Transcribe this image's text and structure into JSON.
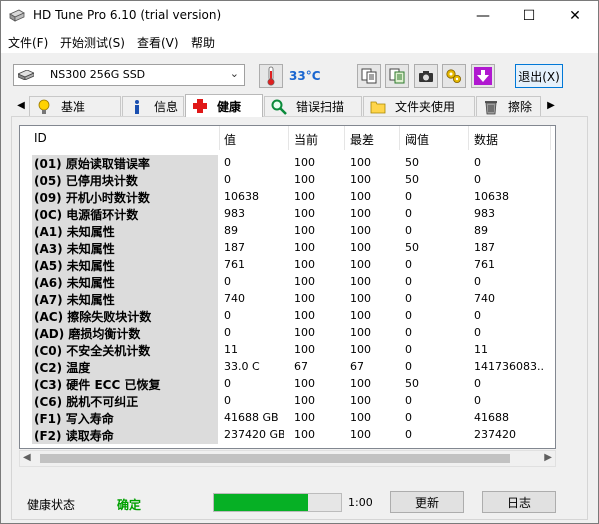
{
  "window": {
    "title": "HD Tune Pro 6.10 (trial version)",
    "controls": {
      "minimize": "—",
      "maximize": "☐",
      "close": "✕"
    }
  },
  "menu": [
    "文件(F)",
    "开始测试(S)",
    "查看(V)",
    "帮助"
  ],
  "toolbar": {
    "drive": "NS300 256G SSD",
    "temperature": "33°C",
    "exit_label": "退出(X)"
  },
  "tabs": [
    {
      "label": "基准",
      "icon": "lightbulb-icon"
    },
    {
      "label": "信息",
      "icon": "info-icon"
    },
    {
      "label": "健康",
      "icon": "health-cross-icon",
      "active": true
    },
    {
      "label": "错误扫描",
      "icon": "magnifier-icon"
    },
    {
      "label": "文件夹使用",
      "icon": "folder-icon"
    },
    {
      "label": "擦除",
      "icon": "trash-icon"
    }
  ],
  "table": {
    "headers": [
      "ID",
      "值",
      "当前",
      "最差",
      "阈值",
      "数据"
    ],
    "rows": [
      [
        "(01) 原始读取错误率",
        "0",
        "100",
        "100",
        "50",
        "0"
      ],
      [
        "(05) 已停用块计数",
        "0",
        "100",
        "100",
        "50",
        "0"
      ],
      [
        "(09) 开机小时数计数",
        "10638",
        "100",
        "100",
        "0",
        "10638"
      ],
      [
        "(0C) 电源循环计数",
        "983",
        "100",
        "100",
        "0",
        "983"
      ],
      [
        "(A1) 未知属性",
        "89",
        "100",
        "100",
        "0",
        "89"
      ],
      [
        "(A3) 未知属性",
        "187",
        "100",
        "100",
        "50",
        "187"
      ],
      [
        "(A5) 未知属性",
        "761",
        "100",
        "100",
        "0",
        "761"
      ],
      [
        "(A6) 未知属性",
        "0",
        "100",
        "100",
        "0",
        "0"
      ],
      [
        "(A7) 未知属性",
        "740",
        "100",
        "100",
        "0",
        "740"
      ],
      [
        "(AC) 擦除失败块计数",
        "0",
        "100",
        "100",
        "0",
        "0"
      ],
      [
        "(AD) 磨损均衡计数",
        "0",
        "100",
        "100",
        "0",
        "0"
      ],
      [
        "(C0) 不安全关机计数",
        "11",
        "100",
        "100",
        "0",
        "11"
      ],
      [
        "(C2) 温度",
        "33.0 C",
        "67",
        "67",
        "0",
        "141736083..."
      ],
      [
        "(C3) 硬件 ECC 已恢复",
        "0",
        "100",
        "100",
        "50",
        "0"
      ],
      [
        "(C6) 脱机不可纠正",
        "0",
        "100",
        "100",
        "0",
        "0"
      ],
      [
        "(F1) 写入寿命",
        "41688 GB",
        "100",
        "100",
        "0",
        "41688"
      ],
      [
        "(F2) 读取寿命",
        "237420 GB",
        "100",
        "100",
        "0",
        "237420"
      ]
    ]
  },
  "status": {
    "label": "健康状态",
    "value": "确定",
    "progress": 0.74,
    "time": "1:00",
    "update_label": "更新",
    "log_label": "日志"
  },
  "colors": {
    "status_ok": "#00a000",
    "progress": "#06b025",
    "temperature": "#1a66d0"
  }
}
